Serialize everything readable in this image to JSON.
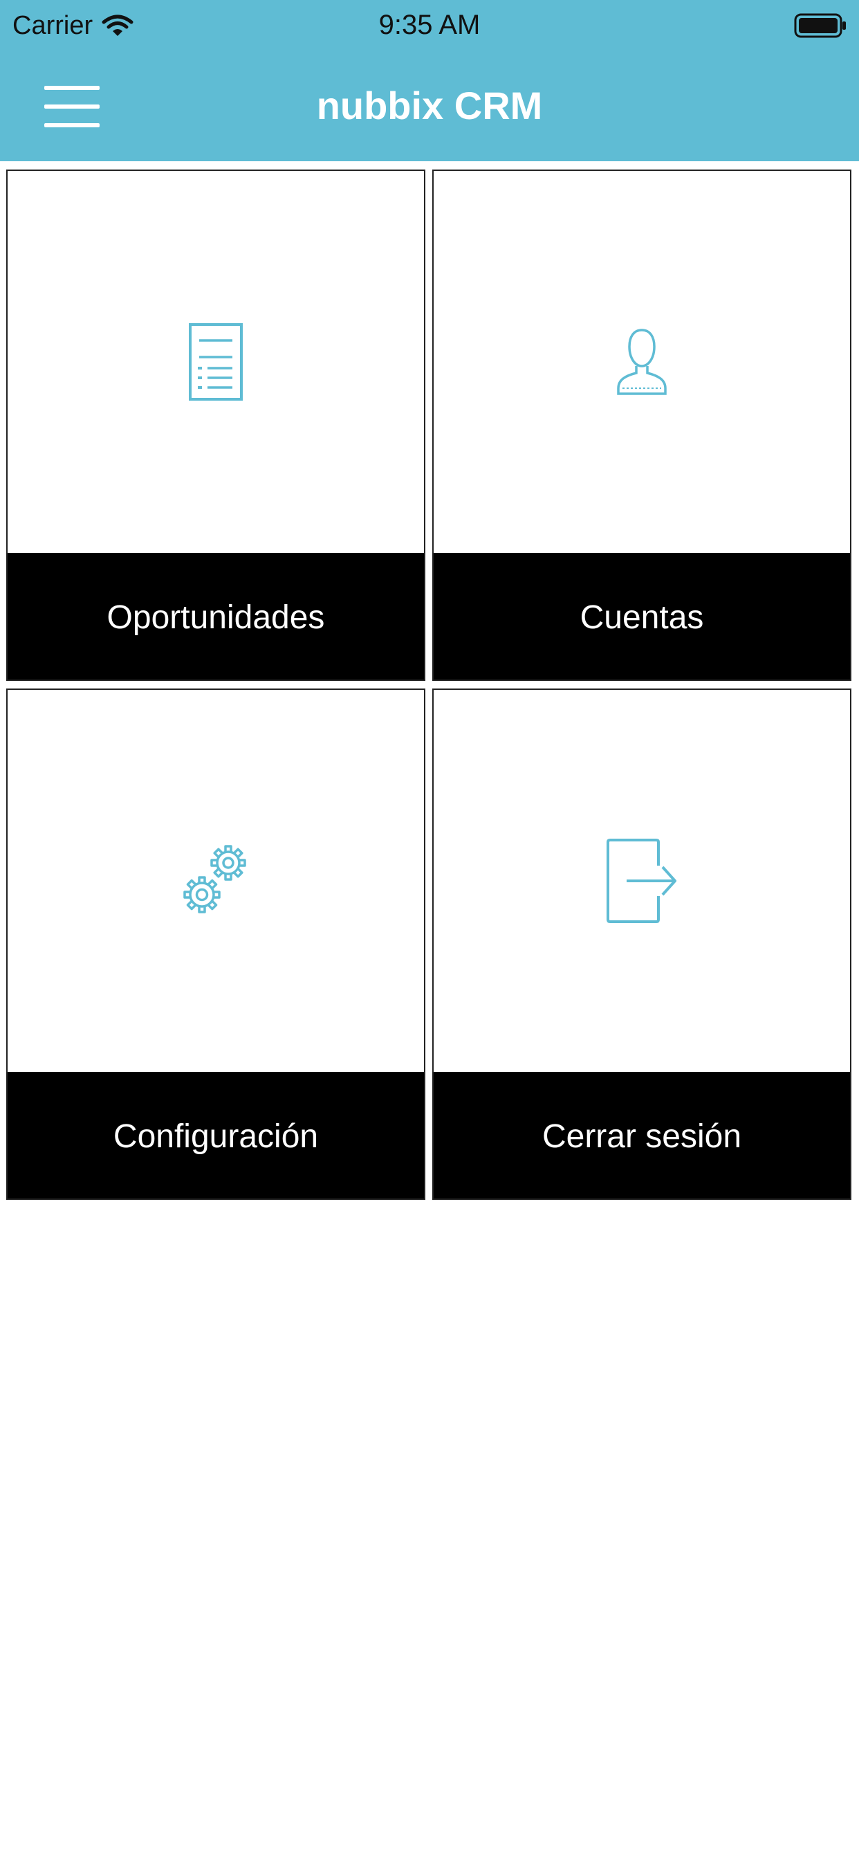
{
  "status_bar": {
    "carrier": "Carrier",
    "time": "9:35 AM",
    "wifi_icon": "wifi-icon",
    "battery_icon": "battery-icon"
  },
  "nav_bar": {
    "title": "nubbix CRM",
    "menu_icon": "hamburger-menu-icon"
  },
  "colors": {
    "header_background": "#5fbcd4",
    "icon_stroke": "#5fbcd4",
    "label_bar_background": "#000000",
    "label_text": "#ffffff",
    "page_background": "#ffffff"
  },
  "tiles": [
    {
      "label": "Oportunidades",
      "icon": "document-list-icon"
    },
    {
      "label": "Cuentas",
      "icon": "user-icon"
    },
    {
      "label": "Configuración",
      "icon": "gears-icon"
    },
    {
      "label": "Cerrar sesión",
      "icon": "logout-icon"
    }
  ]
}
